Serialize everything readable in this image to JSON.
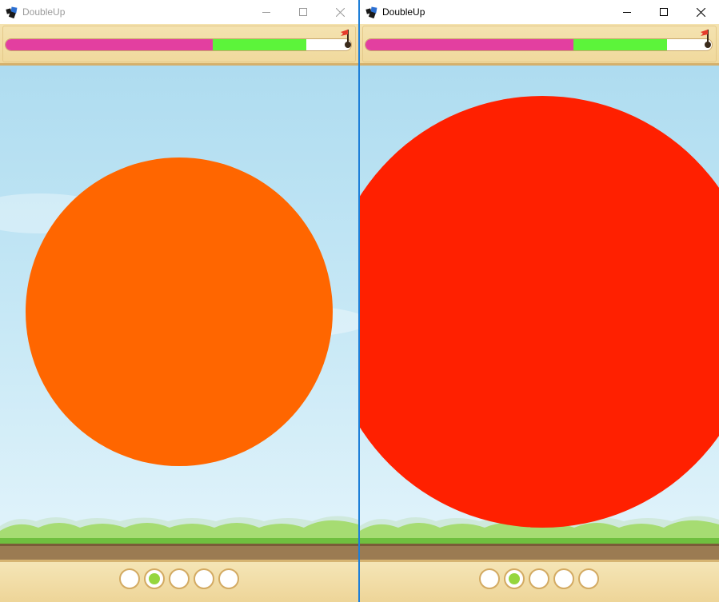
{
  "windows": [
    {
      "title": "DoubleUp",
      "progress": {
        "pink_fraction": 0.6,
        "green_fraction": 0.27
      },
      "circle_color": "#ff6600",
      "active_dot_index": 1,
      "dot_count": 5,
      "focused": false
    },
    {
      "title": "DoubleUp",
      "progress": {
        "pink_fraction": 0.6,
        "green_fraction": 0.27
      },
      "circle_color": "#ff2000",
      "active_dot_index": 1,
      "dot_count": 5,
      "focused": true
    }
  ],
  "icons": {
    "minimize": "minimize-icon",
    "maximize": "maximize-icon",
    "close": "close-icon",
    "flag": "goal-flag-icon"
  },
  "colors": {
    "progress_pink": "#e33fa0",
    "progress_green": "#5cf43a",
    "active_dot": "#95d63e",
    "sky_top": "#aedcf0"
  }
}
